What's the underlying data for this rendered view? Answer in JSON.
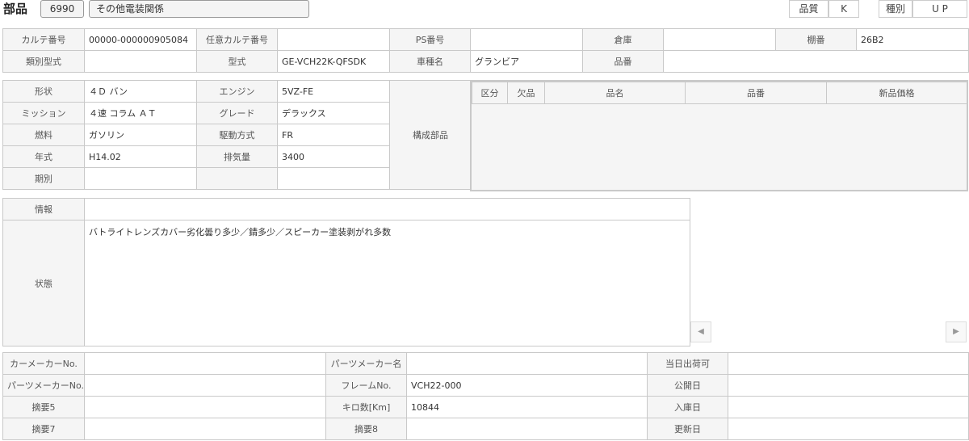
{
  "header": {
    "title": "部品",
    "code": "6990",
    "category": "その他電装関係",
    "quality_label": "品質",
    "quality_value": "K",
    "type_label": "種別",
    "type_value": "U P"
  },
  "row1": {
    "karte_no_label": "カルテ番号",
    "karte_no_value": "00000-000000905084",
    "nini_karte_label": "任意カルテ番号",
    "nini_karte_value": "",
    "ps_label": "PS番号",
    "ps_value": "",
    "warehouse_label": "倉庫",
    "warehouse_value": "",
    "shelf_label": "棚番",
    "shelf_value": "26B2",
    "ruibetsu_label": "類別型式",
    "ruibetsu_value": "",
    "model_label": "型式",
    "model_value": "GE-VCH22K-QFSDK",
    "car_name_label": "車種名",
    "car_name_value": "グランビア",
    "part_no_label": "品番",
    "part_no_value": ""
  },
  "spec": {
    "shape_label": "形状",
    "shape_value": "４Ｄ バン",
    "engine_label": "エンジン",
    "engine_value": "5VZ-FE",
    "mission_label": "ミッション",
    "mission_value": "４速 コラム ＡＴ",
    "grade_label": "グレード",
    "grade_value": "デラックス",
    "fuel_label": "燃料",
    "fuel_value": "ガソリン",
    "drive_label": "駆動方式",
    "drive_value": "FR",
    "year_label": "年式",
    "year_value": "H14.02",
    "displacement_label": "排気量",
    "displacement_value": "3400",
    "period_label": "期別",
    "period_value": "",
    "components_label": "構成部品"
  },
  "components_table": {
    "headers": [
      "区分",
      "欠品",
      "品名",
      "品番",
      "新品価格"
    ]
  },
  "info": {
    "info_label": "情報",
    "info_value": "",
    "status_label": "状態",
    "status_value": "バトライトレンズカバー劣化曇り多少／錆多少／スピーカー塗装剥がれ多数"
  },
  "bottom": {
    "car_maker_no_label": "カーメーカーNo.",
    "car_maker_no_value": "",
    "parts_maker_name_label": "パーツメーカー名",
    "parts_maker_name_value": "",
    "same_day_label": "当日出荷可",
    "same_day_value": "",
    "parts_maker_no_label": "パーツメーカーNo.",
    "parts_maker_no_value": "",
    "frame_no_label": "フレームNo.",
    "frame_no_value": "VCH22-000",
    "release_date_label": "公開日",
    "release_date_value": "",
    "summary5_label": "摘要5",
    "summary5_value": "",
    "mileage_label": "キロ数[Km]",
    "mileage_value": "10844",
    "stock_date_label": "入庫日",
    "stock_date_value": "",
    "summary7_label": "摘要7",
    "summary7_value": "",
    "summary8_label": "摘要8",
    "summary8_value": "",
    "update_date_label": "更新日",
    "update_date_value": ""
  },
  "icons": {
    "scroll_left": "chevron-left-icon",
    "scroll_right": "chevron-right-icon"
  }
}
